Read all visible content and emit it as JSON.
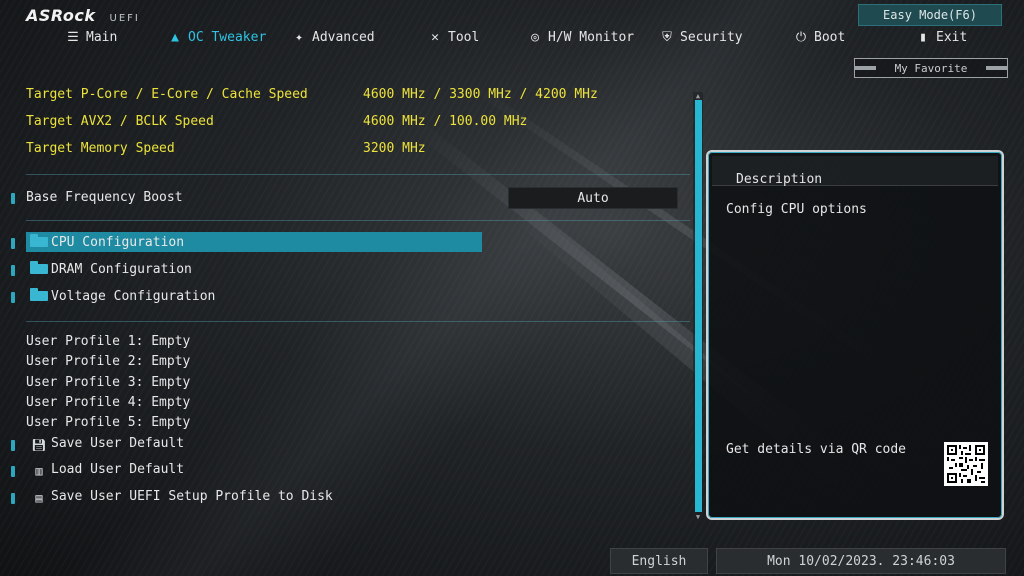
{
  "header": {
    "brand": "ASRock",
    "product": "UEFI",
    "easy_mode_label": "Easy Mode(F6)",
    "favorite_label": "My Favorite"
  },
  "nav": [
    {
      "label": "Main",
      "icon": "list-icon",
      "active": false
    },
    {
      "label": "OC Tweaker",
      "icon": "rocket-icon",
      "active": true
    },
    {
      "label": "Advanced",
      "icon": "star-icon",
      "active": false
    },
    {
      "label": "Tool",
      "icon": "tools-icon",
      "active": false
    },
    {
      "label": "H/W Monitor",
      "icon": "monitor-icon",
      "active": false
    },
    {
      "label": "Security",
      "icon": "shield-icon",
      "active": false
    },
    {
      "label": "Boot",
      "icon": "power-icon",
      "active": false
    },
    {
      "label": "Exit",
      "icon": "exit-icon",
      "active": false
    }
  ],
  "targets": [
    {
      "label": "Target P-Core / E-Core / Cache Speed",
      "value": "4600 MHz / 3300 MHz / 4200 MHz"
    },
    {
      "label": "Target AVX2 / BCLK Speed",
      "value": "4600 MHz / 100.00 MHz"
    },
    {
      "label": "Target Memory Speed",
      "value": "3200 MHz"
    }
  ],
  "base_frequency": {
    "label": "Base Frequency Boost",
    "value": "Auto"
  },
  "configs": [
    {
      "label": "CPU Configuration",
      "selected": true
    },
    {
      "label": "DRAM Configuration",
      "selected": false
    },
    {
      "label": "Voltage Configuration",
      "selected": false
    }
  ],
  "profiles": [
    "User Profile 1: Empty",
    "User Profile 2: Empty",
    "User Profile 3: Empty",
    "User Profile 4: Empty",
    "User Profile 5: Empty"
  ],
  "actions": [
    {
      "label": "Save User Default",
      "icon": "floppy-icon"
    },
    {
      "label": "Load User Default",
      "icon": "book-icon"
    },
    {
      "label": "Save User UEFI Setup Profile to Disk",
      "icon": "disk-save-icon"
    }
  ],
  "description": {
    "title": "Description",
    "body": "Config CPU options",
    "qr_text": "Get details via QR code"
  },
  "footer": {
    "language": "English",
    "datetime": "Mon 10/02/2023. 23:46:03"
  },
  "colors": {
    "accent": "#2fc3e3",
    "highlight": "#1f8ba2",
    "target_text": "#ece23b"
  }
}
